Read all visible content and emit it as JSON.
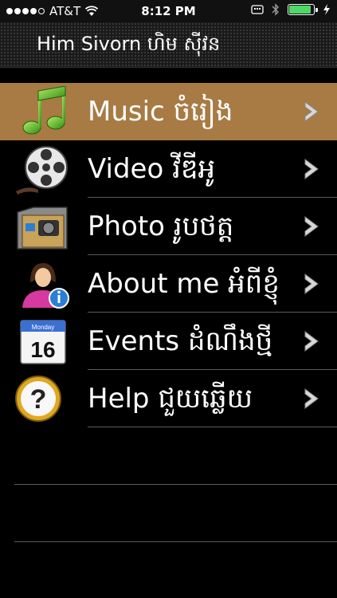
{
  "status_bar": {
    "carrier": "AT&T",
    "time": "8:12 PM",
    "signal_bars": 4,
    "battery_level": 0.9,
    "battery_color": "#4cd964"
  },
  "header": {
    "title": "Him Sivorn ហិម ស៊ីវន"
  },
  "menu": {
    "selected_color": "#a87b44",
    "items": [
      {
        "label": "Music ចំរៀង",
        "icon": "music-note-icon"
      },
      {
        "label": "Video វីឌីអូ",
        "icon": "film-reel-icon"
      },
      {
        "label": "Photo រូបថត្ត",
        "icon": "photo-folder-icon"
      },
      {
        "label": "About me អំពីខ្ញុំ",
        "icon": "user-info-icon"
      },
      {
        "label": "Events ដំណឹងថ្មី",
        "icon": "calendar-icon"
      },
      {
        "label": "Help ជួយឆ្លើយ",
        "icon": "help-icon"
      }
    ]
  },
  "calendar_icon": {
    "weekday": "Monday",
    "day": "16"
  }
}
